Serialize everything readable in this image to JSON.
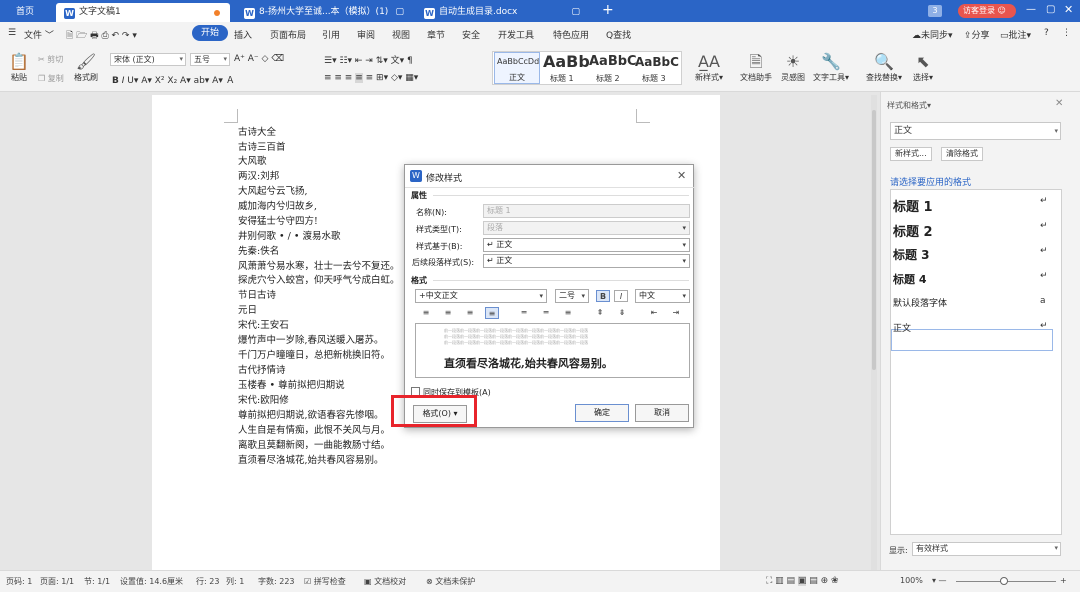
{
  "tabs": [
    {
      "label": "首页"
    },
    {
      "label": "文字文稿1",
      "icon": "W"
    },
    {
      "label": "8-扬州大学至诚...本（模拟）(1)",
      "icon": "W"
    },
    {
      "label": "自动生成目录.docx",
      "icon": "W"
    }
  ],
  "titlebar": {
    "badge": "3",
    "login": "访客登录"
  },
  "menu": {
    "file": "文件",
    "items": [
      "开始",
      "插入",
      "页面布局",
      "引用",
      "审阅",
      "视图",
      "章节",
      "安全",
      "开发工具",
      "特色应用"
    ],
    "search": "Q查找",
    "sync": "未同步",
    "share": "分享",
    "comment": "批注"
  },
  "ribbon": {
    "paste": "粘贴",
    "cut": "剪切",
    "copy": "复制",
    "format_painter": "格式刷",
    "font": "宋体 (正文)",
    "size": "五号",
    "styles": [
      {
        "preview": "AaBbCcDd",
        "name": "正文"
      },
      {
        "preview": "AaBb",
        "name": "标题 1"
      },
      {
        "preview": "AaBbC",
        "name": "标题 2"
      },
      {
        "preview": "AaBbC",
        "name": "标题 3"
      }
    ],
    "new_style": "新样式",
    "doc_assistant": "文档助手",
    "inspiration": "灵感图",
    "text_tools": "文字工具",
    "find_replace": "查找替换",
    "select": "选择"
  },
  "document": {
    "lines": [
      "古诗大全",
      "古诗三百首",
      "大风歌",
      "两汉:刘邦",
      "大风起兮云飞扬,",
      "威加海内兮归故乡,",
      "安得猛士兮守四方!",
      "井别何歌 • / • 渡易水歌",
      "先秦:佚名",
      "风萧萧兮易水寒，壮士一去兮不复还。",
      "探虎穴兮入蛟宫，仰天呼气兮成白虹。",
      "节日古诗",
      "元日",
      "宋代:王安石",
      "爆竹声中一岁除,春风送暖入屠苏。",
      "千门万户曈曈日，总把新桃换旧符。",
      "古代抒情诗",
      "玉楼春 • 尊前拟把归期说",
      "宋代:欧阳修",
      "尊前拟把归期说,欲语春容先惨咽。",
      "人生自是有情痴，此恨不关风与月。",
      "离歌且莫翻新阕，一曲能教肠寸结。",
      "直须看尽洛城花,始共春风容易别。"
    ]
  },
  "dialog": {
    "title": "修改样式",
    "section_props": "属性",
    "name_label": "名称(N):",
    "name_value": "标题 1",
    "type_label": "样式类型(T):",
    "type_value": "段落",
    "based_label": "样式基于(B):",
    "based_value": "↵ 正文",
    "next_label": "后续段落样式(S):",
    "next_value": "↵ 正文",
    "section_format": "格式",
    "font_value": "+中文正文",
    "size_value": "二号",
    "lang_value": "中文",
    "preview_sample": "前一段落前一段落前一段落前一段落前一段落前一段落前一段落前一段落前一段落",
    "preview_text": "直须看尽洛城花,始共春风容易别。",
    "add_template": "同时保存到模板(A)",
    "format_btn": "格式(O)",
    "ok": "确定",
    "cancel": "取消"
  },
  "panel": {
    "title": "样式和格式",
    "current": "正文",
    "new_style": "新样式...",
    "clear": "清除格式",
    "hint": "请选择要应用的格式",
    "styles": [
      {
        "name": "标题 1",
        "mark": "↵"
      },
      {
        "name": "标题 2",
        "mark": "↵"
      },
      {
        "name": "标题 3",
        "mark": "↵"
      },
      {
        "name": "标题 4",
        "mark": "↵"
      },
      {
        "name": "默认段落字体",
        "mark": "a"
      },
      {
        "name": "正文",
        "mark": "↵"
      }
    ],
    "show_label": "显示:",
    "show_value": "有效样式"
  },
  "status": {
    "page": "页码: 1",
    "pages": "页面: 1/1",
    "section": "节: 1/1",
    "setting": "设置值: 14.6厘米",
    "row": "行: 23",
    "col": "列: 1",
    "words": "字数: 223",
    "spell": "拼写检查",
    "proof": "文档校对",
    "protect": "文档未保护",
    "zoom": "100%"
  },
  "colors": {
    "accent": "#2b65c6",
    "highlight": "#e8242b",
    "login": "#e8554e"
  }
}
